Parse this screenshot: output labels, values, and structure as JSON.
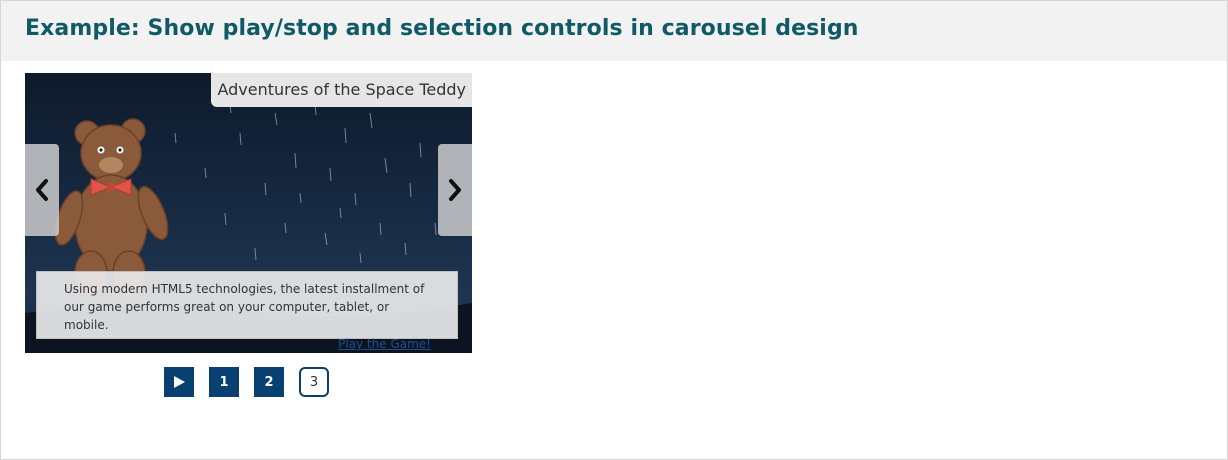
{
  "header": {
    "title": "Example: Show play/stop and selection controls in carousel design"
  },
  "carousel": {
    "slide_title": "Adventures of the Space Teddy",
    "caption_text": "Using modern HTML5 technologies, the latest installment of our game performs great on your computer, tablet, or mobile.",
    "caption_link": "Play the Game!",
    "prev_icon": "chevron-left-icon",
    "next_icon": "chevron-right-icon"
  },
  "controls": {
    "play_icon": "play-icon",
    "slides": [
      "1",
      "2",
      "3"
    ],
    "current_slide": "3"
  },
  "colors": {
    "header_text": "#0f5a66",
    "control_bg": "#074071",
    "link": "#1d4f91"
  }
}
